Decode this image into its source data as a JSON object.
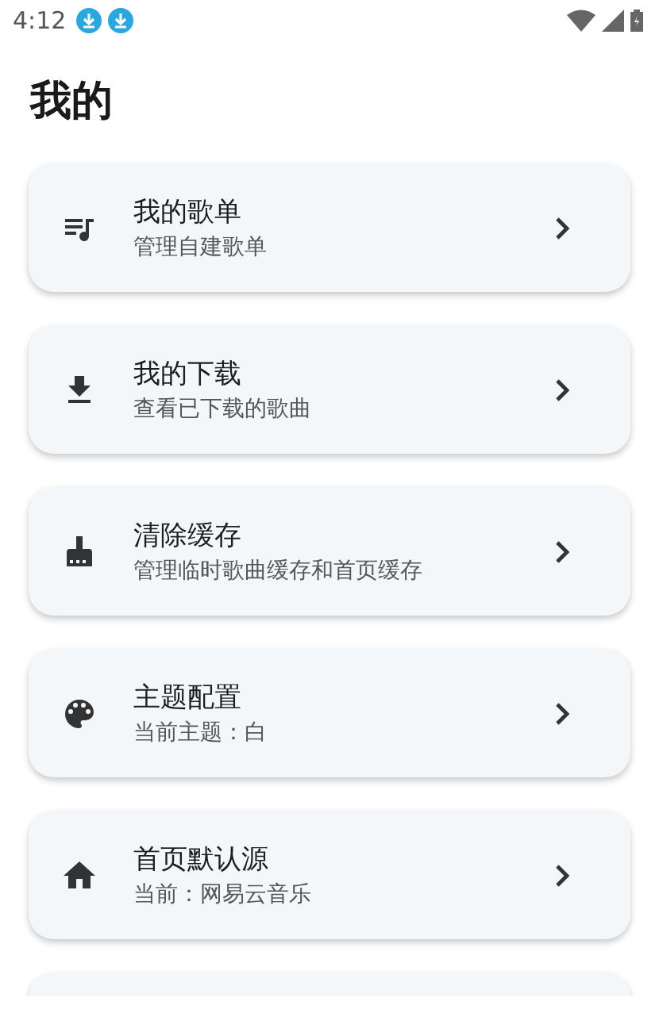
{
  "status_bar": {
    "time": "4:12",
    "notifications": [
      {
        "kind": "download"
      },
      {
        "kind": "download"
      }
    ]
  },
  "page_title": "我的",
  "items": [
    {
      "kind": "playlist",
      "title": "我的歌单",
      "subtitle": "管理自建歌单"
    },
    {
      "kind": "download",
      "title": "我的下载",
      "subtitle": "查看已下载的歌曲"
    },
    {
      "kind": "broom",
      "title": "清除缓存",
      "subtitle": "管理临时歌曲缓存和首页缓存"
    },
    {
      "kind": "palette",
      "title": "主题配置",
      "subtitle": "当前主题：白"
    },
    {
      "kind": "home",
      "title": "首页默认源",
      "subtitle": "当前：网易云音乐"
    },
    {
      "kind": "cut_off"
    }
  ]
}
